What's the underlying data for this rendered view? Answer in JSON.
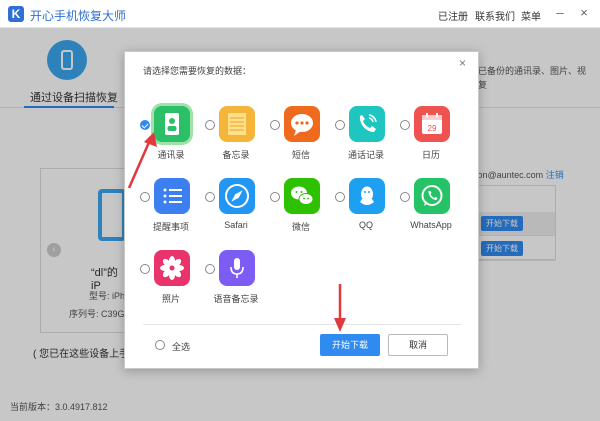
{
  "app": {
    "title": "开心手机恢复大师",
    "logo_letter": "K"
  },
  "menu": {
    "registered": "已注册",
    "contact": "联系我们",
    "menu": "菜单"
  },
  "background": {
    "mode_label": "通过设备扫描恢复",
    "mode_right_line1": "已备份的通讯录、图片、视",
    "mode_right_line2": "复",
    "device_name": "“dl”的 iP",
    "device_model": "型号: iPh",
    "device_serial": "序列号: C39G",
    "note": "( 您已在这些设备上手",
    "account": "rton@auntec.com",
    "logout": "注销",
    "download_label": "开始下载",
    "version": "当前版本：3.0.4917.812"
  },
  "dialog": {
    "title": "请选择您需要恢复的数据：",
    "close": "×",
    "items": [
      {
        "label": "通讯录",
        "icon": "contacts-icon",
        "checked": true
      },
      {
        "label": "备忘录",
        "icon": "notes-icon",
        "checked": false
      },
      {
        "label": "短信",
        "icon": "sms-icon",
        "checked": false
      },
      {
        "label": "通话记录",
        "icon": "call-log-icon",
        "checked": false
      },
      {
        "label": "日历",
        "icon": "calendar-icon",
        "checked": false
      },
      {
        "label": "提醒事项",
        "icon": "reminders-icon",
        "checked": false
      },
      {
        "label": "Safari",
        "icon": "safari-icon",
        "checked": false
      },
      {
        "label": "微信",
        "icon": "wechat-icon",
        "checked": false
      },
      {
        "label": "QQ",
        "icon": "qq-icon",
        "checked": false
      },
      {
        "label": "WhatsApp",
        "icon": "whatsapp-icon",
        "checked": false
      },
      {
        "label": "照片",
        "icon": "photos-icon",
        "checked": false
      },
      {
        "label": "语音备忘录",
        "icon": "voice-memo-icon",
        "checked": false
      }
    ],
    "calendar_day": "29",
    "select_all": "全选",
    "start_button": "开始下载",
    "cancel_button": "取消"
  },
  "colors": {
    "accent": "#2f8bf0",
    "annotation_arrow": "#e0393e"
  }
}
